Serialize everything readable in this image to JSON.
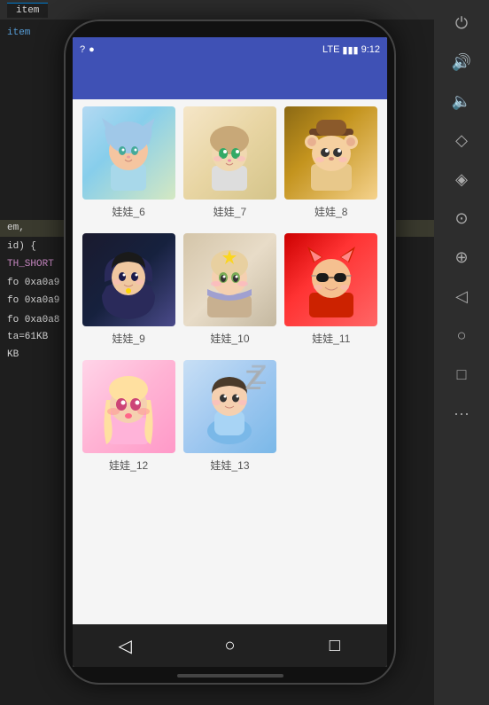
{
  "app": {
    "title": "item",
    "tab_label": "item"
  },
  "editor": {
    "lines": [
      {
        "text": "",
        "style": "white"
      },
      {
        "text": "em,",
        "style": "white"
      },
      {
        "text": "",
        "style": "white"
      },
      {
        "text": "id) {",
        "style": "white"
      },
      {
        "text": "TH_SHORT",
        "style": "purple"
      },
      {
        "text": "",
        "style": "white"
      },
      {
        "text": "fo 0xa0a9",
        "style": "white"
      },
      {
        "text": "fo 0xa0a9",
        "style": "white"
      },
      {
        "text": "",
        "style": "white"
      },
      {
        "text": "fo 0xa0a8",
        "style": "white"
      },
      {
        "text": "ta=61KB",
        "style": "white"
      },
      {
        "text": "KB",
        "style": "white"
      }
    ]
  },
  "toolbar": {
    "icons": [
      {
        "name": "power-icon",
        "symbol": "⏻"
      },
      {
        "name": "volume-up-icon",
        "symbol": "🔊"
      },
      {
        "name": "volume-down-icon",
        "symbol": "🔈"
      },
      {
        "name": "diamond-icon",
        "symbol": "◇"
      },
      {
        "name": "eraser-icon",
        "symbol": "◈"
      },
      {
        "name": "camera-icon",
        "symbol": "⊙"
      },
      {
        "name": "zoom-in-icon",
        "symbol": "⊕"
      },
      {
        "name": "play-back-icon",
        "symbol": "◁"
      },
      {
        "name": "circle-icon",
        "symbol": "○"
      },
      {
        "name": "square-icon",
        "symbol": "□"
      },
      {
        "name": "more-icon",
        "symbol": "···"
      }
    ]
  },
  "phone": {
    "status_bar": {
      "left_icon": "?",
      "signal_icon": "●",
      "lte_label": "LTE",
      "battery_label": "▮▮▮",
      "time": "9:12"
    },
    "nav": {
      "back_label": "◁",
      "home_label": "○",
      "recent_label": "□"
    }
  },
  "grid": {
    "items": [
      {
        "id": 6,
        "label": "娃娃_6",
        "color_class": "char-1",
        "emoji": "😺"
      },
      {
        "id": 7,
        "label": "娃娃_7",
        "color_class": "char-2",
        "emoji": "😊"
      },
      {
        "id": 8,
        "label": "娃娃_8",
        "color_class": "char-3",
        "emoji": "🐻"
      },
      {
        "id": 9,
        "label": "娃娃_9",
        "color_class": "char-4",
        "emoji": "🐱"
      },
      {
        "id": 10,
        "label": "娃娃_10",
        "color_class": "char-5",
        "emoji": "😺"
      },
      {
        "id": 11,
        "label": "娃娃_11",
        "color_class": "char-6",
        "emoji": "🦊"
      },
      {
        "id": 12,
        "label": "娃娃_12",
        "color_class": "char-7",
        "emoji": "👧"
      },
      {
        "id": 13,
        "label": "娃娃_13",
        "color_class": "char-8",
        "emoji": "👦"
      }
    ]
  }
}
